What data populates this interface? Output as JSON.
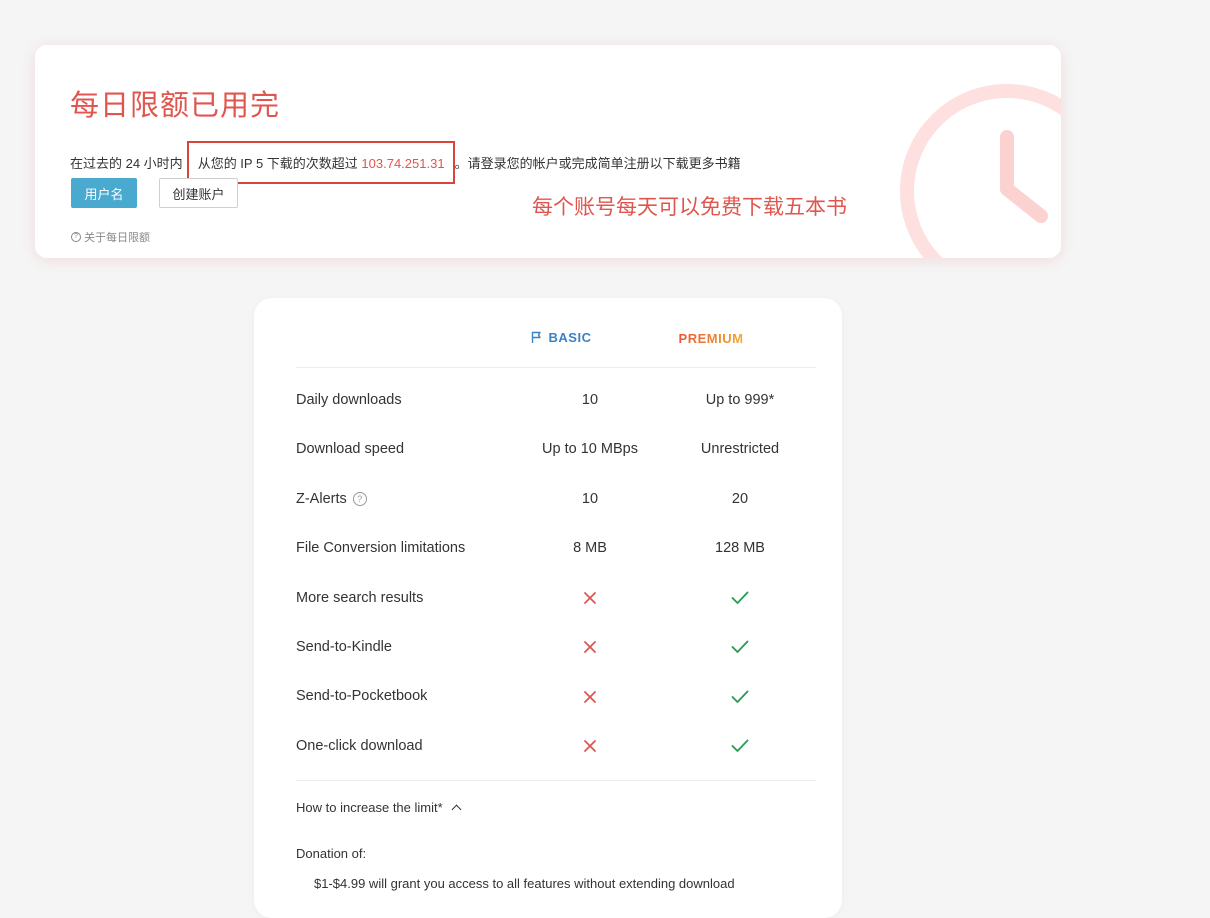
{
  "alert": {
    "title": "每日限额已用完",
    "message_before": "在过去的 24 小时内",
    "message_highlight": "从您的 IP 5 下载的次数超过 ",
    "ip": "103.74.251.31",
    "message_after": "。请登录您的帐户或完成简单注册以下载更多书籍",
    "username_button": "用户名",
    "create_account_button": "创建账户",
    "about_link": "关于每日限额",
    "annotation": "每个账号每天可以免费下载五本书",
    "accent_color": "#e0564f"
  },
  "plans": {
    "basic_label": "BASIC",
    "premium_label": "PREMIUM",
    "basic_color": "#3b82c4"
  },
  "features": [
    {
      "name": "Daily downloads",
      "basic": "10",
      "premium": "Up to 999*"
    },
    {
      "name": "Download speed",
      "basic": "Up to 10 MBps",
      "premium": "Unrestricted"
    },
    {
      "name": "Z-Alerts",
      "basic": "10",
      "premium": "20",
      "help": true
    },
    {
      "name": "File Conversion limitations",
      "basic": "8 MB",
      "premium": "128 MB"
    },
    {
      "name": "More search results",
      "basic": "x-icon",
      "premium": "check-icon"
    },
    {
      "name": "Send-to-Kindle",
      "basic": "x-icon",
      "premium": "check-icon"
    },
    {
      "name": "Send-to-Pocketbook",
      "basic": "x-icon",
      "premium": "check-icon"
    },
    {
      "name": "One-click download",
      "basic": "x-icon",
      "premium": "check-icon"
    }
  ],
  "footer": {
    "increase_limit": "How to increase the limit*",
    "donation_label": "Donation of:",
    "donation_line": "$1-$4.99 will grant you access to all features without extending download"
  }
}
